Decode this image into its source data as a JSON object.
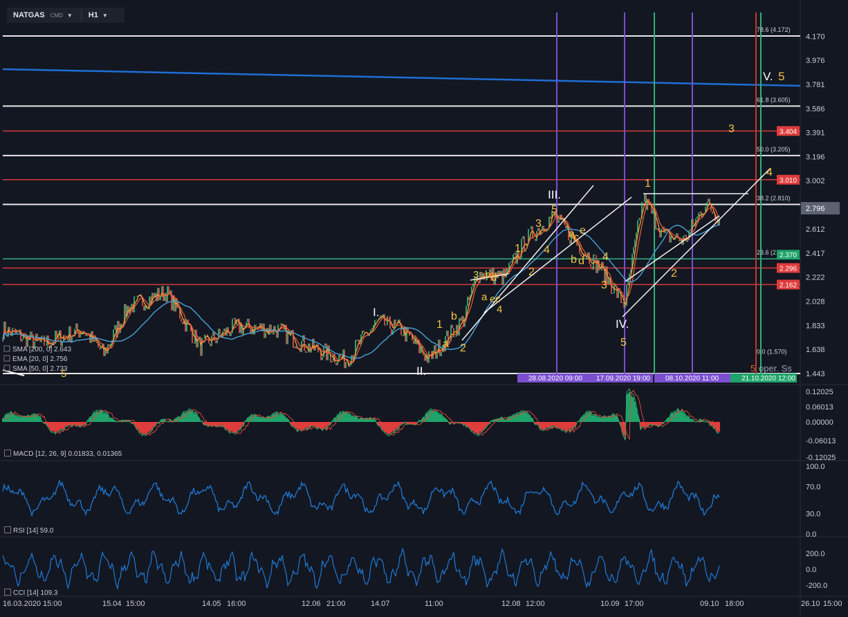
{
  "toolbar": {
    "symbol": "NATGAS",
    "symbol_type": "CMD",
    "timeframe": "H1"
  },
  "colors": {
    "background": "#131722",
    "white_level": "#e8e8e8",
    "red_level": "#d43b3b",
    "green_level": "#2fb27b",
    "purple_vline": "#7b4fd0",
    "green_vline": "#2fb27b",
    "trendline": "#1e6fd6",
    "wave_label": "#f4c542",
    "sma200": "#4aa3d8",
    "ema20": "#f2a33a",
    "sma50": "#e05a3c",
    "macd_pos": "#1fa36a",
    "macd_neg": "#e03c3c",
    "rsi": "#1f7ad6",
    "cci": "#1f7ad6"
  },
  "main_panel": {
    "price_axis": [
      "4.170",
      "3.976",
      "3.781",
      "3.586",
      "3.391",
      "3.196",
      "3.002",
      "2.807",
      "2.612",
      "2.417",
      "2.222",
      "2.028",
      "1.833",
      "1.638",
      "1.443"
    ],
    "current_price": "2.796",
    "red_level_labels": [
      "3.404",
      "3.010",
      "2.296",
      "2.162"
    ],
    "green_level_label": "2.370",
    "fib_labels": [
      "78.6 (4.172)",
      "61.8 (3.605)",
      "50.0 (3.205)",
      "38.2 (2.810)",
      "23.6 (2.370)",
      "0.0 (1.570)"
    ],
    "date_markers": [
      "28.08.2020 09:00",
      "17.09.2020 19:00",
      "08.10.2020 11:00",
      "21.10.2020 12:00"
    ],
    "overlay_legend": [
      "SMA [200, 0] 2.643",
      "EMA [20, 0] 2.756",
      "SMA [50, 0] 2.733"
    ],
    "wave_labels": [
      "I.",
      "II.",
      "III.",
      "IV.",
      "V.",
      "1",
      "2",
      "3",
      "4",
      "5",
      "a",
      "b",
      "c",
      "d",
      "e"
    ],
    "wave_label_texts": {
      "I": "I.",
      "II": "II.",
      "III": "III.",
      "IV": "IV.",
      "V": "V.",
      "n1": "1",
      "n2": "2",
      "n3": "3",
      "n4": "4",
      "n5": "5",
      "a": "a",
      "b": "b",
      "c": "c",
      "d": "d",
      "e": "e"
    },
    "extra_label": "5",
    "target_text": "oper. Ss"
  },
  "macd_panel": {
    "legend": "MACD [12, 26, 9] 0.01833, 0.01365",
    "axis": [
      "0.12025",
      "0.06013",
      "0.00000",
      "-0.06013",
      "-0.12025"
    ]
  },
  "rsi_panel": {
    "legend": "RSI [14] 59.0",
    "axis": [
      "100.0",
      "70.0",
      "30.0",
      "0.0"
    ]
  },
  "cci_panel": {
    "legend": "CCI [14] 109.3",
    "axis": [
      "200.0",
      "0.0",
      "-200.0"
    ]
  },
  "time_axis": [
    "16.03.2020",
    "15:00",
    "15.04",
    "15:00",
    "14.05",
    "16:00",
    "12.06",
    "21:00",
    "14.07",
    "11:00",
    "12.08",
    "12:00",
    "10.09",
    "17:00",
    "09.10",
    "18:00",
    "26.10",
    "15:00"
  ],
  "chart_data": {
    "type": "line",
    "title": "NATGAS",
    "timeframe": "H1",
    "x_range": [
      "16.03.2020",
      "26.10.2020"
    ],
    "ylim": [
      1.443,
      4.172
    ],
    "approx_closes": {
      "x": [
        "16.03.2020",
        "15.04",
        "14.05",
        "12.06",
        "14.07",
        "12.08",
        "28.08.2020",
        "10.09",
        "17.09.2020",
        "08.10.2020",
        "09.10"
      ],
      "y": [
        1.78,
        1.68,
        1.85,
        1.72,
        1.56,
        2.3,
        2.78,
        2.3,
        2.0,
        2.42,
        2.8
      ]
    },
    "horizontal_levels": {
      "white": [
        4.172,
        3.605,
        3.205,
        2.81,
        1.443
      ],
      "red": [
        3.404,
        3.01,
        2.296,
        2.162
      ],
      "green": [
        2.37
      ]
    },
    "fibonacci": [
      {
        "ratio": "78.6",
        "value": 4.172
      },
      {
        "ratio": "61.8",
        "value": 3.605
      },
      {
        "ratio": "50.0",
        "value": 3.205
      },
      {
        "ratio": "38.2",
        "value": 2.81
      },
      {
        "ratio": "23.6",
        "value": 2.37
      },
      {
        "ratio": "0.0",
        "value": 1.57
      }
    ],
    "indicators": {
      "SMA200": 2.643,
      "EMA20": 2.756,
      "SMA50": 2.733,
      "MACD": [
        0.01833,
        0.01365
      ],
      "RSI": 59.0,
      "CCI": 109.3
    },
    "grid": false
  }
}
